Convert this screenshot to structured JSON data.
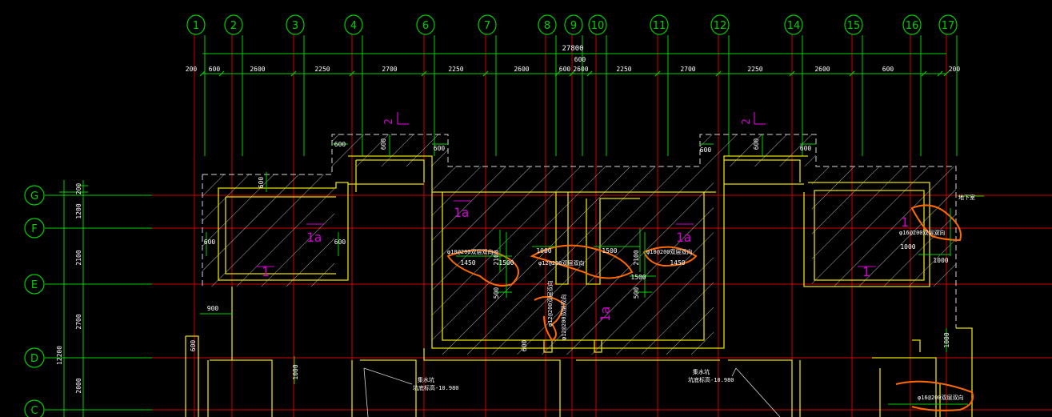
{
  "colors": {
    "background": "#000000",
    "grid_green": "#00d000",
    "axis_red": "#d00000",
    "wall_yellow": "#e8e000",
    "hatch_white": "#d8d8d8",
    "annotation_magenta": "#d000d0",
    "rebar_orange": "#ff6a00",
    "text_white": "#ffffff"
  },
  "column_axes": [
    "1",
    "2",
    "3",
    "4",
    "6",
    "7",
    "8",
    "9",
    "10",
    "11",
    "12",
    "14",
    "15",
    "16",
    "17"
  ],
  "row_axes": [
    "G",
    "F",
    "E",
    "D",
    "C"
  ],
  "overall_dimension": "27800",
  "top_dimensions": [
    "200",
    "600",
    "2600",
    "2250",
    "2700",
    "2250",
    "2600",
    "600",
    "2600",
    "2250",
    "2700",
    "2250",
    "2600",
    "600",
    "200"
  ],
  "dimension_600_upper": "600",
  "left_dimensions": [
    "200",
    "1200",
    "2100",
    "2700",
    "2000"
  ],
  "left_total": "12200",
  "section_marks": [
    "2",
    "2"
  ],
  "zone_labels": [
    "1a",
    "1a",
    "1a",
    "1a",
    "1",
    "1",
    "1"
  ],
  "small_dims": {
    "d600_a": "600",
    "d600_b": "600",
    "d600_c": "600",
    "d600_d": "600",
    "d600_e": "600",
    "d600_f": "600",
    "d600_g": "600",
    "d600_h": "600",
    "d600_i": "600",
    "d600_j": "600",
    "d600_k": "600",
    "d900": "900",
    "d1000_a": "1000",
    "d1000_b": "1000",
    "d1000_c": "1000",
    "d1000_d": "1000",
    "d1000_e": "1000",
    "d1450_a": "1450",
    "d1450_b": "1450",
    "d1500_a": "1500",
    "d1500_b": "1500",
    "d1500_c": "1500",
    "d2100_a": "2100",
    "d2100_b": "2100",
    "d500_a": "500",
    "d500_b": "500"
  },
  "rebar_notes": {
    "n1": "φ10@200双层双向",
    "n2": "φ12@200双层双向",
    "n3": "φ10@200双层双向",
    "n4": "φ12@200双层双向",
    "n5": "φ16@200双层双向",
    "n6": "φ16@200双层双向",
    "n7": "φ12@200双层双向"
  },
  "elev_notes": {
    "e1_title": "集水坑",
    "e1_value": "坑底标高-10.980",
    "e2_title": "集水坑",
    "e2_value": "坑底标高-10.980",
    "right_tag": "地下室"
  }
}
